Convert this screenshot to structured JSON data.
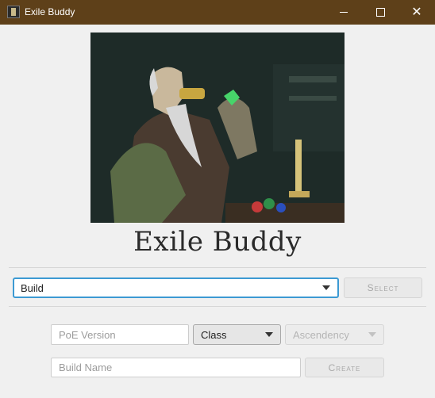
{
  "window": {
    "title": "Exile Buddy"
  },
  "header": {
    "app_name": "Exile Buddy"
  },
  "build_row": {
    "build_select_value": "Build",
    "select_button_label": "Select"
  },
  "create_row": {
    "poe_version_placeholder": "PoE Version",
    "class_select_value": "Class",
    "ascendency_select_value": "Ascendency",
    "build_name_placeholder": "Build Name",
    "create_button_label": "Create"
  },
  "colors": {
    "titlebar": "#5e4019",
    "focus_border": "#3c9ad3",
    "background": "#f0f0f0"
  }
}
